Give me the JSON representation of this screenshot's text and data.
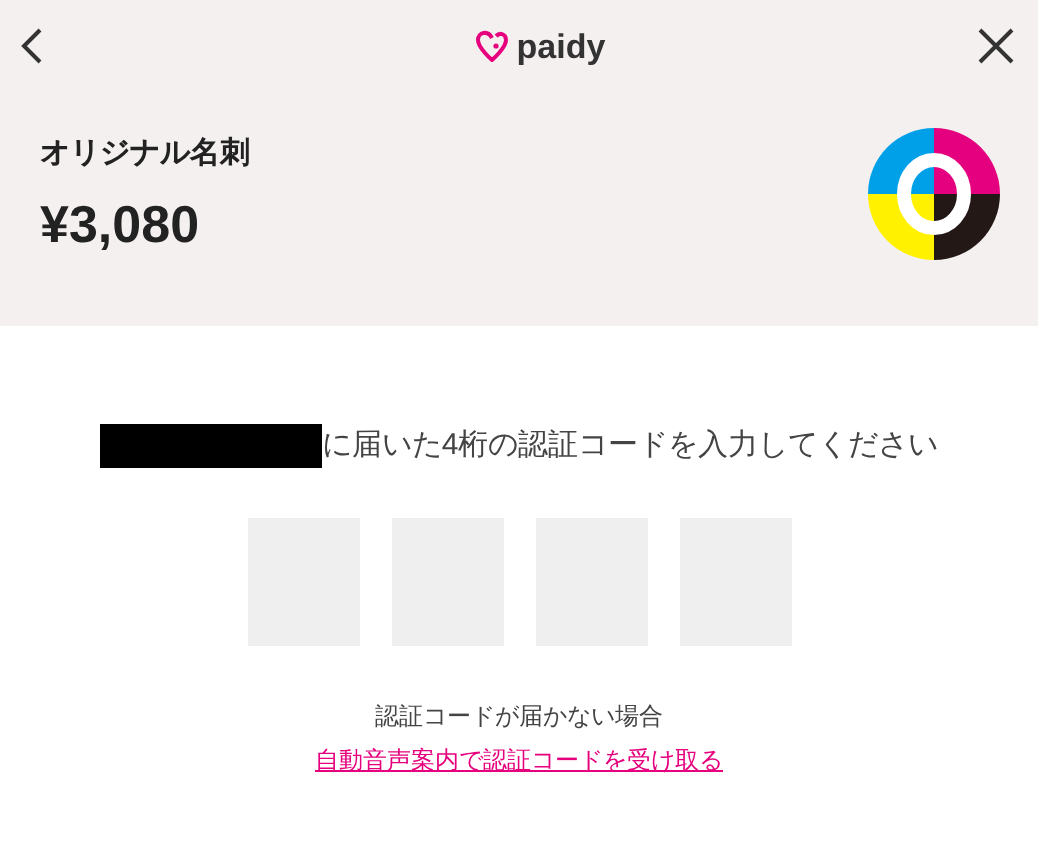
{
  "header": {
    "logo": "paidy"
  },
  "order": {
    "title": "オリジナル名刺",
    "price": "¥3,080"
  },
  "verification": {
    "instruction": "に届いた4桁の認証コードを入力してください",
    "code_digits": [
      {
        "kind": "empty"
      },
      {
        "kind": "empty"
      },
      {
        "kind": "empty"
      },
      {
        "kind": "empty"
      }
    ],
    "help_text": "認証コードが届かない場合",
    "voice_link": "自動音声案内で認証コードを受け取る"
  }
}
